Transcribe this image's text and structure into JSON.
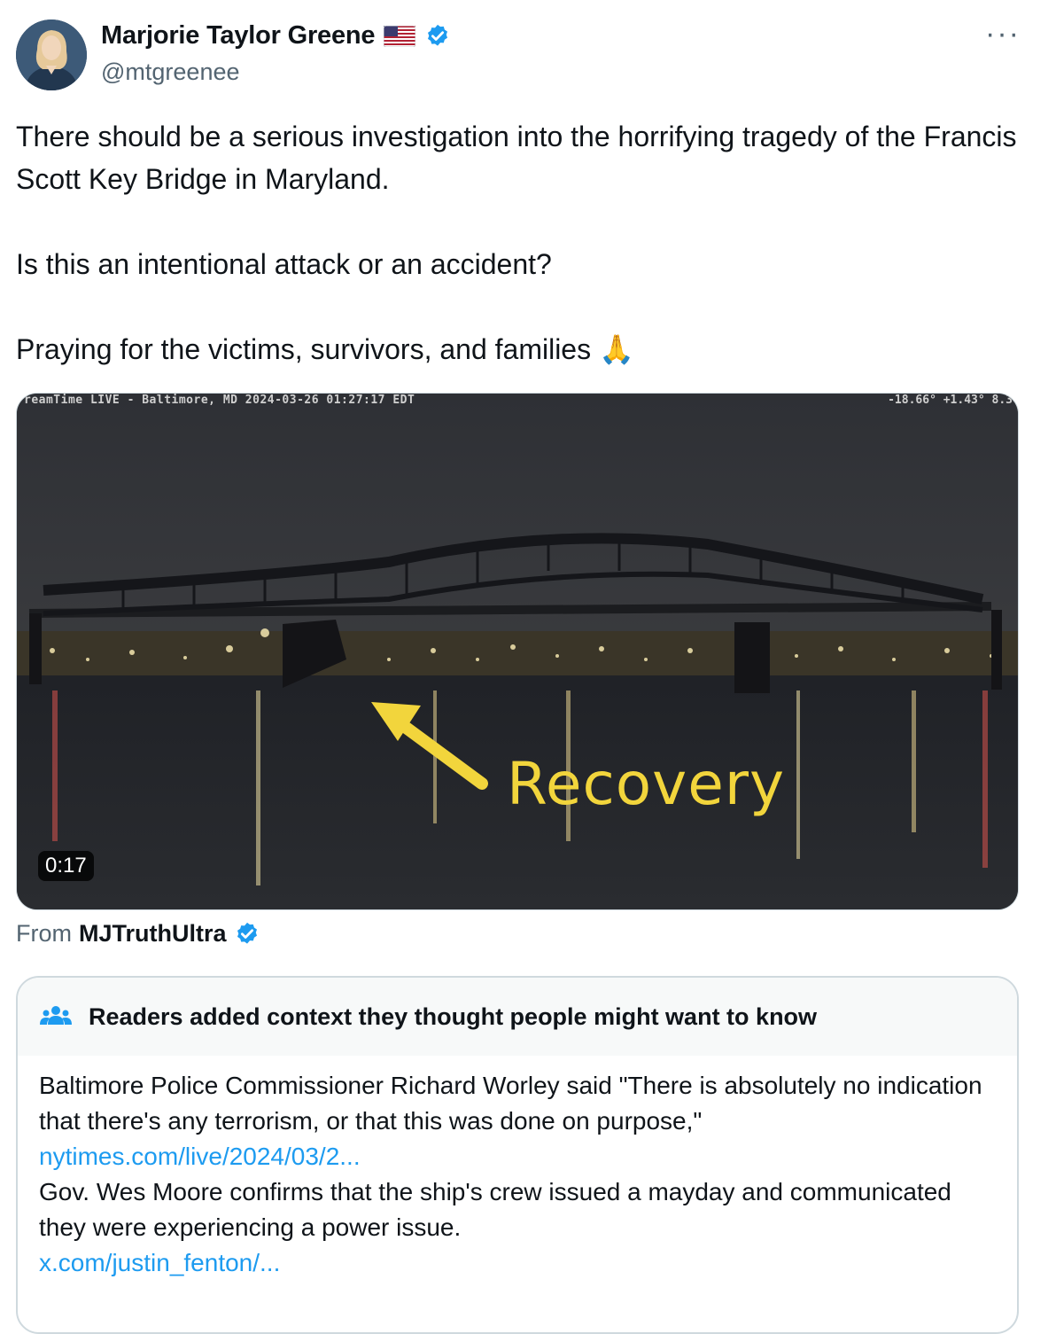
{
  "author": {
    "display_name": "Marjorie Taylor Greene",
    "handle": "@mtgreenee",
    "flag": "us-flag-icon",
    "verified": true
  },
  "more_label": "···",
  "tweet": {
    "line1": "There should be a serious investigation into the horrifying tragedy of the Francis Scott Key Bridge in Maryland.",
    "line2": "Is this an intentional attack or an accident?",
    "line3": "Praying for the victims, survivors, and families 🙏"
  },
  "media": {
    "overlay_left": "reamTime LIVE - Baltimore, MD 2024-03-26  01:27:17 EDT",
    "overlay_right": "-18.66° +1.43° 8.3",
    "caption_overlay": "Recovery",
    "duration": "0:17"
  },
  "source": {
    "from_label": "From",
    "account": "MJTruthUltra"
  },
  "community_note": {
    "title": "Readers added context they thought people might want to know",
    "text1": "Baltimore Police Commissioner Richard Worley said \"There is absolutely no indication that there's any terrorism, or that this was done on purpose,\"",
    "link1": "nytimes.com/live/2024/03/2...",
    "text2": "Gov. Wes Moore confirms that the ship's crew issued a mayday and communicated they were experiencing a power issue.",
    "link2": "x.com/justin_fenton/..."
  },
  "colors": {
    "link": "#1d9bf0",
    "verified": "#1d9bf0",
    "secondary_text": "#536471",
    "recovery_text": "#f2d53c"
  }
}
